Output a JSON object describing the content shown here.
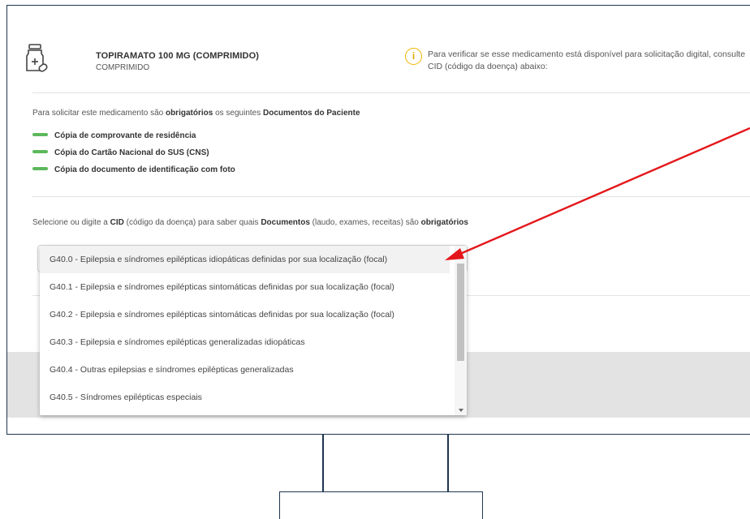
{
  "medicine": {
    "name": "TOPIRAMATO 100 MG (COMPRIMIDO)",
    "form": "COMPRIMIDO",
    "icon": "medicine-bottle-icon"
  },
  "info": {
    "icon": "info-icon",
    "text": "Para verificar se esse medicamento está disponível para solicitação digital, consulte CID (código da doença) abaixo:"
  },
  "requirements": {
    "title_prefix": "Para solicitar este medicamento são ",
    "title_bold1": "obrigatórios",
    "title_mid": " os seguintes ",
    "title_bold2": "Documentos do Paciente",
    "items": [
      "Cópia de comprovante de residência",
      "Cópia do Cartão Nacional do SUS (CNS)",
      "Cópia do documento de identificação com foto"
    ],
    "dash_color": "#5cb85c"
  },
  "cid": {
    "title_prefix": "Selecione ou digite a ",
    "title_bold1": "CID",
    "title_mid": " (código da doença) para saber quais ",
    "title_bold2": "Documentos",
    "title_mid2": " (laudo, exames, receitas) são ",
    "title_bold3": "obrigatórios",
    "options": [
      "G40.0 - Epilepsia e síndromes epilépticas idiopáticas definidas por sua localização (focal)",
      "G40.1 - Epilepsia e síndromes epilépticas sintomáticas definidas por sua localização (focal)",
      "G40.2 - Epilepsia e síndromes epilépticas sintomáticas definidas por sua localização (focal)",
      "G40.3 - Epilepsia e síndromes epilépticas generalizadas idiopáticas",
      "G40.4 - Outras epilepsias e síndromes epilépticas generalizadas",
      "G40.5 - Síndromes epilépticas especiais"
    ]
  },
  "annotation": {
    "arrow_color": "#e3171b"
  }
}
